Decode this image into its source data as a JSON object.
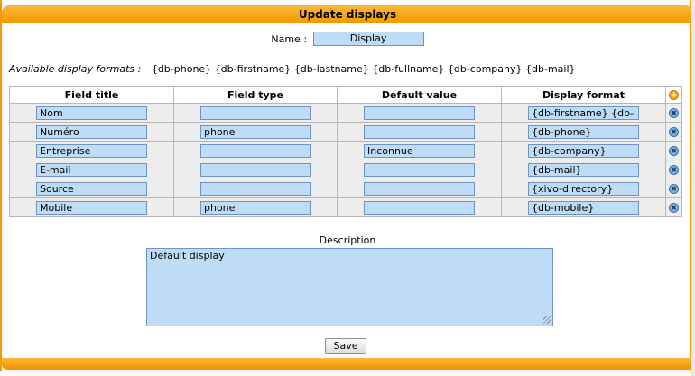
{
  "header": {
    "title": "Update displays"
  },
  "name_field": {
    "label": "Name :",
    "value": "Display"
  },
  "formats": {
    "label": "Available display formats :",
    "items": [
      "{db-phone}",
      "{db-firstname}",
      "{db-lastname}",
      "{db-fullname}",
      "{db-company}",
      "{db-mail}"
    ]
  },
  "table": {
    "headers": [
      "Field title",
      "Field type",
      "Default value",
      "Display format"
    ],
    "add_icon": "plus-icon",
    "delete_icon": "remove-icon",
    "rows": [
      {
        "title": "Nom",
        "type": "",
        "default": "",
        "format": "{db-firstname} {db-l"
      },
      {
        "title": "Numéro",
        "type": "phone",
        "default": "",
        "format": "{db-phone}"
      },
      {
        "title": "Entreprise",
        "type": "",
        "default": "Inconnue",
        "format": "{db-company}"
      },
      {
        "title": "E-mail",
        "type": "",
        "default": "",
        "format": "{db-mail}"
      },
      {
        "title": "Source",
        "type": "",
        "default": "",
        "format": "{xivo-directory}"
      },
      {
        "title": "Mobile",
        "type": "phone",
        "default": "",
        "format": "{db-mobile}"
      }
    ]
  },
  "description": {
    "label": "Description",
    "value": "Default display"
  },
  "save_label": "Save",
  "colors": {
    "accent": "#f39a00",
    "field_bg": "#bfdcf7",
    "field_border": "#6d94c4"
  }
}
